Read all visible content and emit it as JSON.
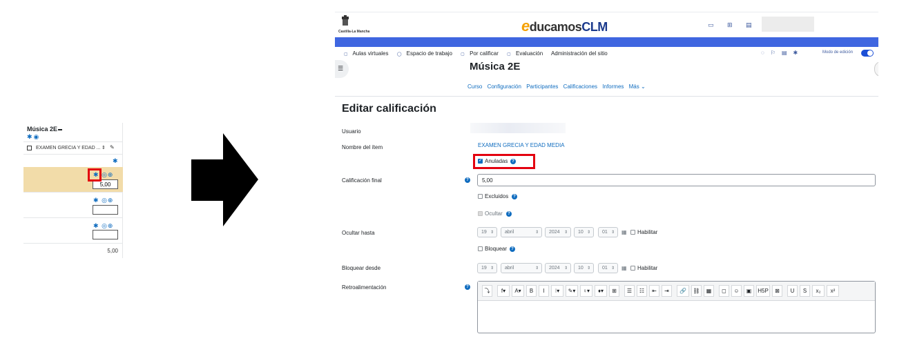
{
  "mini": {
    "course_title": "Música 2E",
    "item_name": "EXAMEN GRECIA Y EDAD ...",
    "rows": [
      {
        "value": "5,00"
      },
      {
        "value": ""
      },
      {
        "value": ""
      }
    ],
    "total": "5,00",
    "highlight_color": "#f2dca9",
    "callout_color": "#e3000f"
  },
  "site": {
    "brand_e": "e",
    "brand_mid": "ducamos",
    "brand_clm": "CLM",
    "crest_text": "Castilla-La Mancha",
    "accent": "#3f66e0"
  },
  "nav": {
    "items": [
      "Aulas virtuales",
      "Espacio de trabajo",
      "Por calificar",
      "Evaluación",
      "Administración del sitio"
    ],
    "edit_mode_label": "Modo de edición"
  },
  "course": {
    "title": "Música 2E",
    "secondary_nav": [
      "Curso",
      "Configuración",
      "Participantes",
      "Calificaciones",
      "Informes",
      "Más ⌄"
    ]
  },
  "form": {
    "page_title": "Editar calificación",
    "user_label": "Usuario",
    "item_label": "Nombre del ítem",
    "item_value": "EXAMEN GRECIA Y EDAD MEDIA",
    "overridden_label": "Anuladas",
    "final_grade_label": "Calificación final",
    "final_grade_value": "5,00",
    "excluded_label": "Excluidos",
    "hide_label": "Ocultar",
    "hidden_until_label": "Ocultar hasta",
    "locked_label": "Bloquear",
    "locked_after_label": "Bloquear desde",
    "feedback_label": "Retroalimentación",
    "date": {
      "day": "19",
      "month": "abril",
      "year": "2024",
      "hour": "10",
      "minute": "01"
    },
    "enable_label": "Habilitar"
  },
  "editor_toolbar": [
    "⤵",
    "f▾",
    "A▾",
    "B",
    "I",
    "⁝▾",
    "✎▾",
    "♀▾",
    "♦▾",
    "⊞",
    "☰",
    "☷",
    "⇤",
    "⇥",
    "🔗",
    "⛓",
    "▦",
    "◻",
    "☺",
    "▣",
    "H5P",
    "⊠",
    "U",
    "S",
    "x₂",
    "x²"
  ]
}
